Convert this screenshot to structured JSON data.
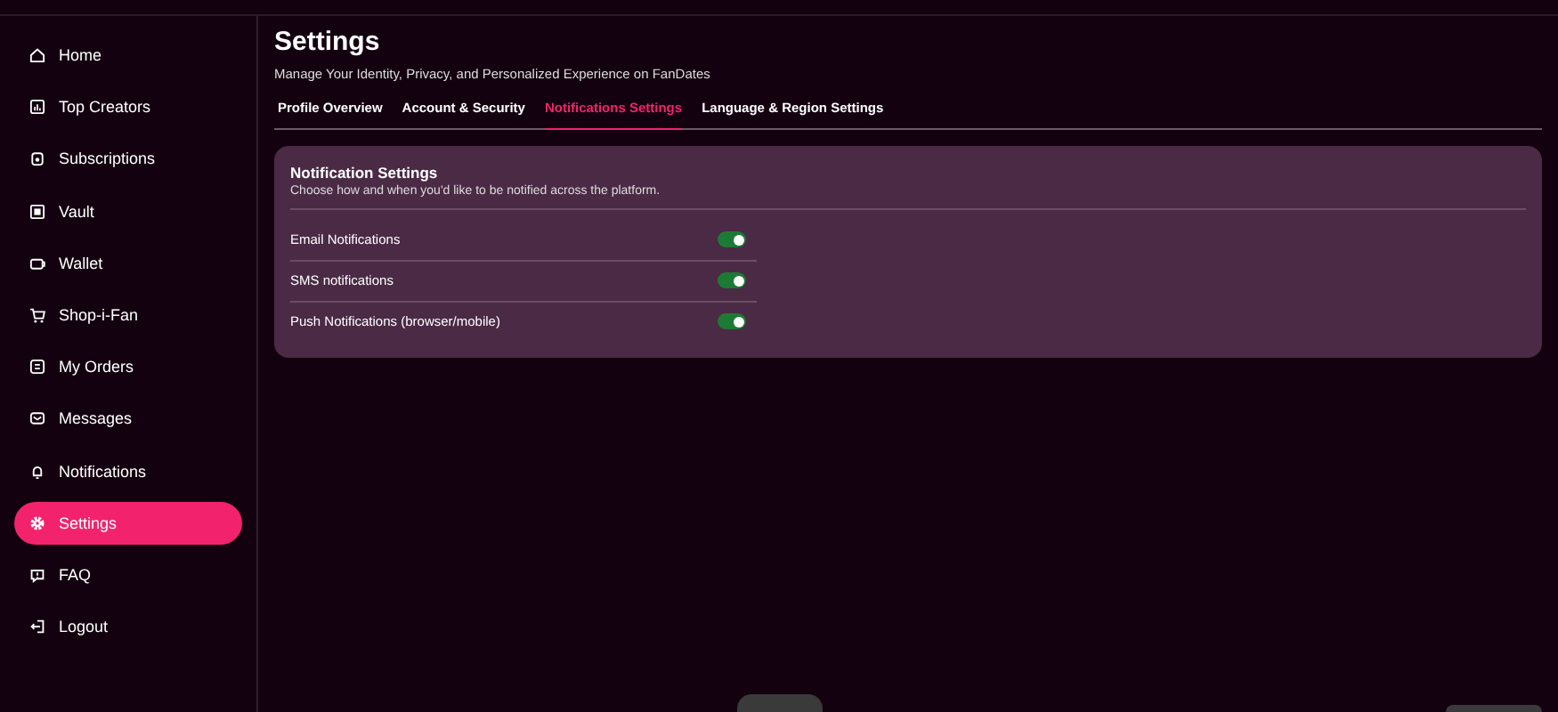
{
  "sidebar": {
    "items": [
      {
        "label": "Home",
        "selected": false
      },
      {
        "label": "Top Creators",
        "selected": false
      },
      {
        "label": "Subscriptions",
        "selected": false
      },
      {
        "label": "Vault",
        "selected": false
      },
      {
        "label": "Wallet",
        "selected": false
      },
      {
        "label": "Shop-i-Fan",
        "selected": false
      },
      {
        "label": "My Orders",
        "selected": false
      },
      {
        "label": "Messages",
        "selected": false
      },
      {
        "label": "Notifications",
        "selected": false
      },
      {
        "label": "Settings",
        "selected": true
      },
      {
        "label": "FAQ",
        "selected": false
      },
      {
        "label": "Logout",
        "selected": false
      }
    ]
  },
  "page": {
    "title": "Settings",
    "subtitle": "Manage Your Identity, Privacy, and Personalized Experience on FanDates"
  },
  "tabs": [
    {
      "label": "Profile Overview",
      "selected": false
    },
    {
      "label": "Account & Security",
      "selected": false
    },
    {
      "label": "Notifications Settings",
      "selected": true
    },
    {
      "label": "Language & Region Settings",
      "selected": false
    }
  ],
  "card": {
    "title": "Notification Settings",
    "description": "Choose how and when you'd like to be notified across the platform.",
    "settings": [
      {
        "label": "Email Notifications",
        "on": true
      },
      {
        "label": "SMS notifications",
        "on": true
      },
      {
        "label": "Push Notifications (browser/mobile)",
        "on": true
      }
    ]
  }
}
